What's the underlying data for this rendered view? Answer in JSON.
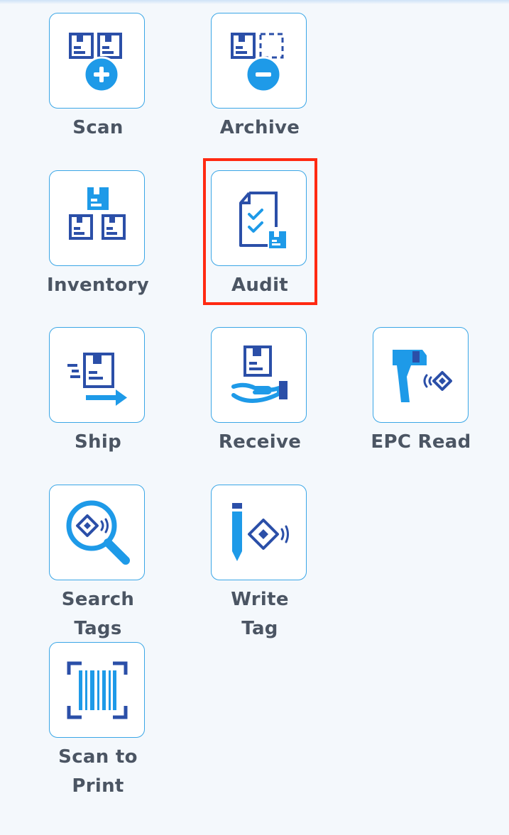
{
  "tiles": [
    {
      "id": "scan",
      "label": "Scan",
      "icon": "scan-add-icon"
    },
    {
      "id": "archive",
      "label": "Archive",
      "icon": "archive-remove-icon"
    },
    {
      "id": "inventory",
      "label": "Inventory",
      "icon": "inventory-boxes-icon"
    },
    {
      "id": "audit",
      "label": "Audit",
      "icon": "audit-checklist-icon"
    },
    {
      "id": "ship",
      "label": "Ship",
      "icon": "ship-box-icon"
    },
    {
      "id": "receive",
      "label": "Receive",
      "icon": "receive-hand-icon"
    },
    {
      "id": "epc_read",
      "label": "EPC Read",
      "icon": "rfid-reader-icon"
    },
    {
      "id": "search_tags",
      "label_line1": "Search",
      "label_line2": "Tags",
      "icon": "search-tag-icon"
    },
    {
      "id": "write_tag",
      "label_line1": "Write",
      "label_line2": "Tag",
      "icon": "write-tag-icon"
    },
    {
      "id": "scan_to_print",
      "label_line1": "Scan to",
      "label_line2": "Print",
      "icon": "barcode-scan-icon"
    }
  ],
  "selected": "Audit",
  "colors": {
    "accent_blue": "#1e9ae8",
    "dark_blue": "#2b4fa8",
    "tile_border": "#3aa6e6",
    "label_gray": "#4b5563",
    "highlight_red": "#ff2a12",
    "background": "#f4f8fc"
  }
}
